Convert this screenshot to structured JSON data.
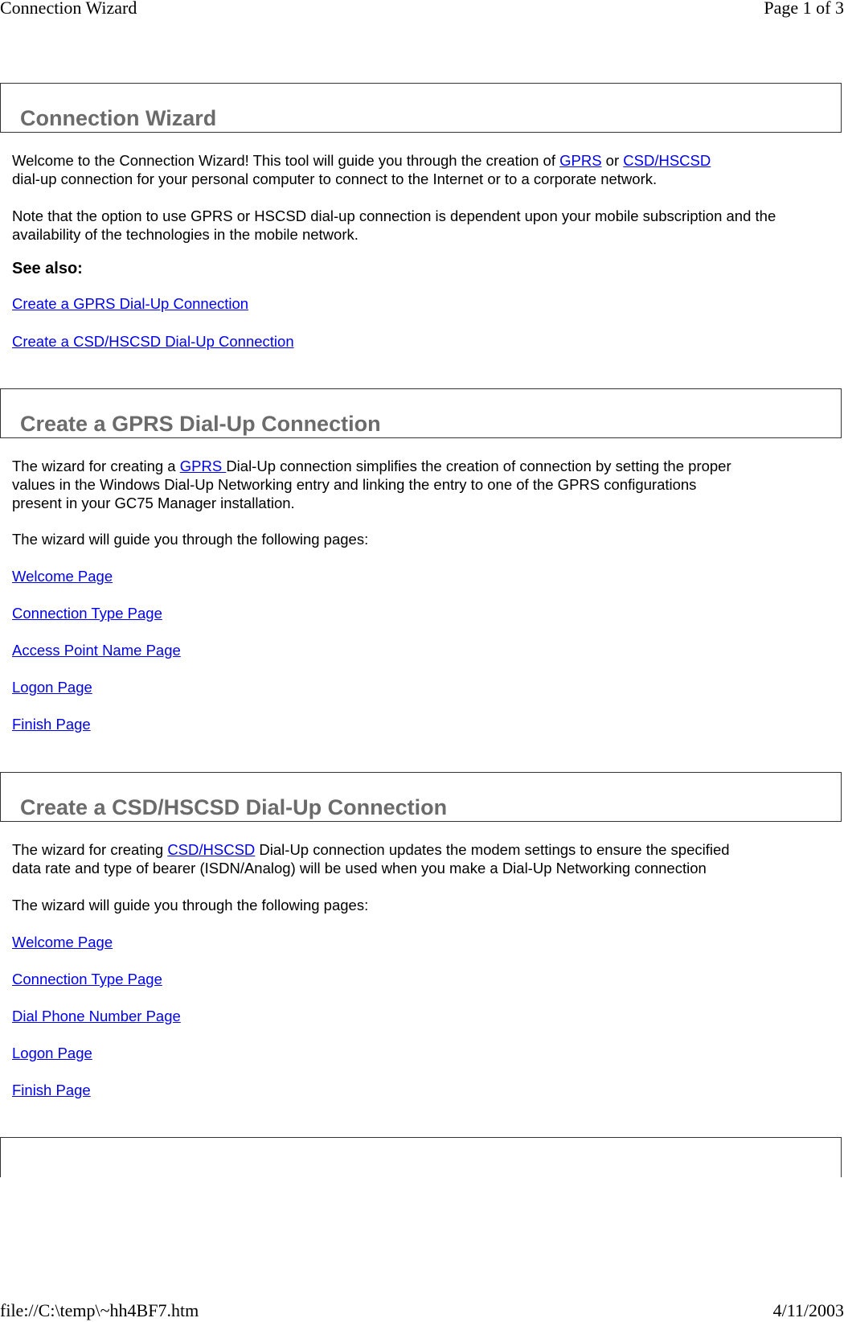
{
  "print_header": {
    "title": "Connection Wizard",
    "page_indicator": "Page 1 of 3"
  },
  "print_footer": {
    "file_path": "file://C:\\temp\\~hh4BF7.htm",
    "date": "4/11/2003"
  },
  "colors": {
    "heading": "#6b6b6b",
    "link": "#0000ee",
    "border": "#333333"
  },
  "sections": {
    "intro": {
      "heading": "Connection Wizard",
      "p1_a": "Welcome to the Connection Wizard! This tool will guide you through the creation of ",
      "p1_link1": "GPRS",
      "p1_b": " or ",
      "p1_link2": "CSD/HSCSD",
      "p1_c": "dial-up connection for your personal computer to connect to the Internet or to a corporate network.",
      "p2": "Note that the option to use GPRS or HSCSD dial-up connection is dependent upon your mobile subscription and the availability of the technologies in the mobile network.",
      "see_also_label": "See also:",
      "see_also_links": [
        "Create a GPRS Dial-Up Connection",
        "Create a CSD/HSCSD Dial-Up Connection"
      ]
    },
    "gprs": {
      "heading": "Create a GPRS Dial-Up Connection",
      "p1_a": "The wizard for creating a ",
      "p1_link": "GPRS ",
      "p1_b": "Dial-Up connection simplifies the creation of connection by setting the proper",
      "p1_c": "values in the Windows Dial-Up Networking entry and linking the entry to one of the GPRS configurations",
      "p1_d": "present in your GC75 Manager installation.",
      "p2": "The wizard will guide you through the following pages:",
      "pages": [
        "Welcome Page",
        "Connection Type Page",
        "Access Point Name Page",
        "Logon Page",
        "Finish Page"
      ]
    },
    "csd": {
      "heading": "Create a CSD/HSCSD Dial-Up Connection",
      "p1_a": "The wizard for creating ",
      "p1_link": "CSD/HSCSD",
      "p1_b": " Dial-Up connection updates the modem settings to ensure the specified",
      "p1_c": "data rate and type of bearer (ISDN/Analog) will be used when you make a Dial-Up Networking connection",
      "p2": "The wizard will guide you through the following pages:",
      "pages": [
        "Welcome Page",
        "Connection Type Page",
        "Dial Phone Number Page",
        "Logon Page",
        "Finish Page"
      ]
    }
  }
}
